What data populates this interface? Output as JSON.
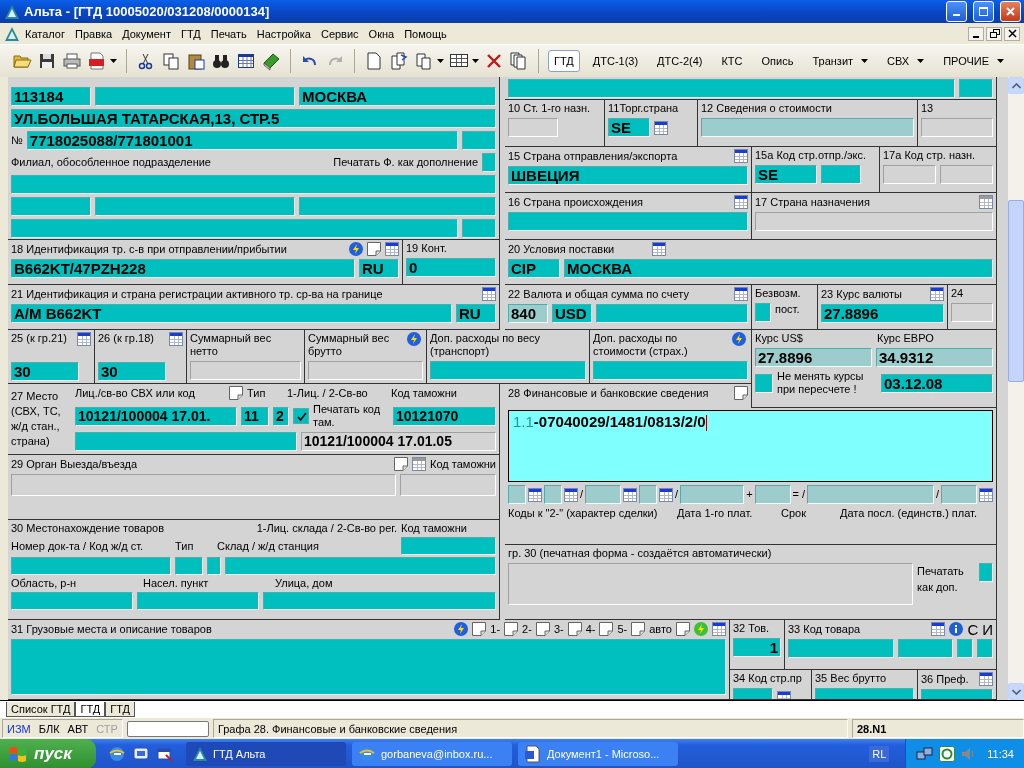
{
  "window": {
    "title": "Альта - [ГТД 10005020/031208/0000134]"
  },
  "menu": [
    "Каталог",
    "Правка",
    "Документ",
    "ГТД",
    "Печать",
    "Настройка",
    "Сервис",
    "Окна",
    "Помощь"
  ],
  "document_tabs": [
    {
      "label": "ГТД",
      "selected": true,
      "has_menu": false
    },
    {
      "label": "ДТС-1(3)",
      "selected": false,
      "has_menu": false
    },
    {
      "label": "ДТС-2(4)",
      "selected": false,
      "has_menu": false
    },
    {
      "label": "КТС",
      "selected": false,
      "has_menu": false
    },
    {
      "label": "Опись",
      "selected": false,
      "has_menu": false
    },
    {
      "label": "Транзит",
      "selected": false,
      "has_menu": true
    },
    {
      "label": "СВХ",
      "selected": false,
      "has_menu": true
    },
    {
      "label": "ПРОЧИЕ",
      "selected": false,
      "has_menu": true
    }
  ],
  "form": {
    "cells": [
      {
        "lines": [
          [
            {
              "kind": "input",
              "value": "113184"
            },
            {
              "kind": "input"
            },
            {
              "kind": "input",
              "value": "МОСКВА"
            }
          ],
          [
            {
              "kind": "input",
              "value": "УЛ.БОЛЬШАЯ ТАТАРСКАЯ,13, СТР.5"
            }
          ],
          [
            {
              "kind": "label",
              "text": "№"
            },
            {
              "kind": "input",
              "value": "7718025088/771801001"
            },
            {
              "kind": "input"
            }
          ],
          [
            {
              "kind": "label",
              "text": "Филиал, обособленное подразделение"
            },
            {
              "kind": "label",
              "text": "Печатать Ф. как дополнение"
            },
            {
              "kind": "input"
            }
          ],
          [
            {
              "kind": "input"
            }
          ],
          [
            {
              "kind": "input"
            },
            {
              "kind": "input"
            },
            {
              "kind": "input"
            }
          ],
          [
            {
              "kind": "input"
            },
            {
              "kind": "input"
            }
          ]
        ]
      },
      {
        "lines": [
          [
            {
              "kind": "input"
            },
            {
              "kind": "input"
            }
          ]
        ]
      },
      {
        "lines": [
          [
            {
              "kind": "label",
              "text": "10 Ст. 1-го назн."
            }
          ],
          [
            {
              "kind": "blank"
            }
          ]
        ]
      },
      {
        "lines": [
          [
            {
              "kind": "label",
              "text": "11Торг.страна"
            }
          ],
          [
            {
              "kind": "input",
              "value": "SE"
            },
            {
              "kind": "picker",
              "disabled": false
            }
          ]
        ]
      },
      {
        "lines": [
          [
            {
              "kind": "label",
              "text": "12 Сведения о стоимости"
            }
          ],
          [
            {
              "kind": "output"
            }
          ]
        ]
      },
      {
        "lines": [
          [
            {
              "kind": "label",
              "text": "13"
            }
          ],
          [
            {
              "kind": "blank"
            }
          ]
        ]
      },
      {
        "lines": [
          [
            {
              "kind": "label",
              "text": "15 Страна отправления/экспорта"
            },
            {
              "kind": "picker",
              "disabled": false
            }
          ],
          [
            {
              "kind": "input",
              "value": "ШВЕЦИЯ"
            }
          ]
        ]
      },
      {
        "lines": [
          [
            {
              "kind": "label",
              "text": "15а Код стр.отпр./экс."
            }
          ],
          [
            {
              "kind": "input",
              "value": "SE"
            },
            {
              "kind": "input"
            }
          ]
        ]
      },
      {
        "lines": [
          [
            {
              "kind": "label",
              "text": "17а Код стр. назн."
            }
          ],
          [
            {
              "kind": "blank"
            },
            {
              "kind": "blank"
            }
          ]
        ]
      },
      {
        "lines": [
          [
            {
              "kind": "label",
              "text": "16 Страна происхождения"
            },
            {
              "kind": "picker",
              "disabled": false
            }
          ],
          [
            {
              "kind": "input"
            }
          ]
        ]
      },
      {
        "lines": [
          [
            {
              "kind": "label",
              "text": "17 Страна назначения"
            },
            {
              "kind": "picker",
              "disabled": true
            }
          ],
          [
            {
              "kind": "blank"
            }
          ]
        ]
      },
      {
        "lines": [
          [
            {
              "kind": "label",
              "text": "18 Идентификация тр. с-в при отправлении/прибытии"
            },
            {
              "kind": "calc",
              "color": "#1f5fe0"
            },
            {
              "kind": "note"
            },
            {
              "kind": "picker",
              "disabled": false
            }
          ],
          [
            {
              "kind": "input",
              "value": "B662KT/47PZH228"
            },
            {
              "kind": "input",
              "value": "RU"
            }
          ]
        ]
      },
      {
        "lines": [
          [
            {
              "kind": "label",
              "text": "19 Конт."
            }
          ],
          [
            {
              "kind": "input",
              "value": "0"
            }
          ]
        ]
      },
      {
        "lines": [
          [
            {
              "kind": "label",
              "text": "20 Условия поставки"
            },
            {
              "kind": "picker",
              "disabled": false
            }
          ],
          [
            {
              "kind": "input",
              "value": "CIP"
            },
            {
              "kind": "input",
              "value": "МОСКВА"
            }
          ]
        ]
      },
      {
        "lines": [
          [
            {
              "kind": "label",
              "text": "21 Идентификация и страна регистрации активного тр. ср-ва на границе"
            },
            {
              "kind": "picker",
              "disabled": false
            }
          ],
          [
            {
              "kind": "input",
              "value": "A/M B662KT"
            },
            {
              "kind": "input",
              "value": "RU"
            }
          ]
        ]
      },
      {
        "lines": [
          [
            {
              "kind": "label",
              "text": "22 Валюта и общая сумма по счету"
            },
            {
              "kind": "picker",
              "disabled": false
            }
          ],
          [
            {
              "kind": "output",
              "value": "840"
            },
            {
              "kind": "input",
              "value": "USD"
            },
            {
              "kind": "input"
            }
          ]
        ]
      },
      {
        "lines": [
          [
            {
              "kind": "label",
              "text": "Безвозм."
            }
          ],
          [
            {
              "kind": "input"
            },
            {
              "kind": "label",
              "text": "пост."
            }
          ]
        ]
      },
      {
        "lines": [
          [
            {
              "kind": "label",
              "text": "23 Курс валюты"
            },
            {
              "kind": "picker",
              "disabled": false
            }
          ],
          [
            {
              "kind": "input",
              "value": "27.8896"
            }
          ]
        ]
      },
      {
        "lines": [
          [
            {
              "kind": "label",
              "text": "24"
            }
          ],
          [
            {
              "kind": "blank"
            }
          ]
        ]
      },
      {
        "lines": [
          [
            {
              "kind": "label",
              "text": "25 (к гр.21)"
            },
            {
              "kind": "picker",
              "disabled": false
            }
          ],
          [
            {
              "kind": "input",
              "value": "30"
            }
          ]
        ]
      },
      {
        "lines": [
          [
            {
              "kind": "label",
              "text": "26 (к гр.18)"
            },
            {
              "kind": "picker",
              "disabled": false
            }
          ],
          [
            {
              "kind": "input",
              "value": "30"
            }
          ]
        ]
      },
      {
        "lines": [
          [
            {
              "kind": "label",
              "text": "Суммарный вес нетто"
            }
          ],
          [
            {
              "kind": "blank"
            }
          ]
        ]
      },
      {
        "lines": [
          [
            {
              "kind": "label",
              "text": "Суммарный вес брутто"
            },
            {
              "kind": "calc",
              "color": "#1f5fe0"
            }
          ],
          [
            {
              "kind": "blank"
            }
          ]
        ]
      },
      {
        "lines": [
          [
            {
              "kind": "label",
              "text": "Доп. расходы по весу (транспорт)"
            }
          ],
          [
            {
              "kind": "input"
            }
          ]
        ]
      },
      {
        "lines": [
          [
            {
              "kind": "label",
              "text": "Доп. расходы по стоимости (страх.)"
            },
            {
              "kind": "calc",
              "color": "#1f5fe0"
            }
          ],
          [
            {
              "kind": "input"
            }
          ]
        ]
      },
      {
        "lines": [
          [
            {
              "kind": "label",
              "text": "Курс US$"
            },
            {
              "kind": "label",
              "text": "Курс ЕВРО"
            }
          ],
          [
            {
              "kind": "output",
              "value": "27.8896"
            },
            {
              "kind": "output",
              "value": "34.9312"
            }
          ],
          [
            {
              "kind": "input"
            },
            {
              "kind": "label",
              "text": "Не менять курсы при пересчете !"
            },
            {
              "kind": "input",
              "value": "03.12.08"
            }
          ]
        ]
      },
      {
        "aside": "27  Место (СВХ, ТС, ж/д стан., страна)",
        "lines": [
          [
            {
              "kind": "label",
              "text": "Лиц./св-во СВХ или код"
            },
            {
              "kind": "note"
            },
            {
              "kind": "label",
              "text": "Тип"
            },
            {
              "kind": "label",
              "text": "1-Лиц. / 2-Св-во"
            },
            {
              "kind": "label",
              "text": "Код таможни"
            }
          ],
          [
            {
              "kind": "input",
              "value": "10121/100004 17.01."
            },
            {
              "kind": "input",
              "value": "11"
            },
            {
              "kind": "input",
              "value": "2"
            },
            {
              "kind": "checkbox",
              "checked": true
            },
            {
              "kind": "label",
              "text": "Печатать код там."
            },
            {
              "kind": "input",
              "value": "10121070"
            }
          ],
          [
            {
              "kind": "input"
            },
            {
              "kind": "blank",
              "value": "10121/100004 17.01.05"
            }
          ]
        ]
      },
      {
        "lines": [
          [
            {
              "kind": "label",
              "text": "28 Финансовые и банковские сведения"
            },
            {
              "kind": "note"
            }
          ]
        ]
      },
      {
        "lines": [
          [
            {
              "kind": "label",
              "text": "29 Орган Выезда/въезда"
            },
            {
              "kind": "note"
            },
            {
              "kind": "picker",
              "disabled": true
            },
            {
              "kind": "label",
              "text": "Код таможни"
            }
          ],
          [
            {
              "kind": "blank"
            },
            {
              "kind": "blank"
            }
          ]
        ]
      },
      {
        "lines": [
          [
            {
              "kind": "memo",
              "prefix": "1.1",
              "value": "-07040029/1481/0813/2/0"
            }
          ],
          [
            {
              "kind": "output"
            },
            {
              "kind": "picker",
              "disabled": false
            },
            {
              "kind": "output"
            },
            {
              "kind": "picker",
              "disabled": false
            },
            {
              "kind": "label",
              "text": "/"
            },
            {
              "kind": "output"
            },
            {
              "kind": "picker",
              "disabled": false
            },
            {
              "kind": "output"
            },
            {
              "kind": "picker",
              "disabled": false
            },
            {
              "kind": "label",
              "text": "/"
            },
            {
              "kind": "output"
            },
            {
              "kind": "label",
              "text": "+"
            },
            {
              "kind": "output"
            },
            {
              "kind": "label",
              "text": "= /"
            },
            {
              "kind": "output"
            },
            {
              "kind": "label",
              "text": "/"
            },
            {
              "kind": "output"
            },
            {
              "kind": "picker",
              "disabled": false
            }
          ],
          [
            {
              "kind": "label",
              "text": "Коды к \"2-\" (характер сделки)"
            },
            {
              "kind": "label",
              "text": "Дата 1-го плат."
            },
            {
              "kind": "label",
              "text": "Срок"
            },
            {
              "kind": "label",
              "text": "Дата посл. (единств.) плат."
            }
          ]
        ]
      },
      {
        "lines": [
          [
            {
              "kind": "label",
              "text": "30 Местонахождение товаров"
            },
            {
              "kind": "label",
              "text": "1-Лиц. склада / 2-Св-во рег."
            },
            {
              "kind": "label",
              "text": "Код таможни"
            }
          ],
          [
            {
              "kind": "label",
              "text": "Номер док-та / Код ж/д ст."
            },
            {
              "kind": "label",
              "text": "Тип"
            },
            {
              "kind": "label",
              "text": "Склад / ж/д станция"
            },
            {
              "kind": "input"
            }
          ],
          [
            {
              "kind": "input"
            },
            {
              "kind": "input"
            },
            {
              "kind": "input"
            },
            {
              "kind": "input"
            }
          ],
          [
            {
              "kind": "label",
              "text": "Область, р-н"
            },
            {
              "kind": "label",
              "text": "Насел. пункт"
            },
            {
              "kind": "label",
              "text": "Улица, дом"
            }
          ],
          [
            {
              "kind": "input"
            },
            {
              "kind": "input"
            },
            {
              "kind": "input"
            }
          ]
        ]
      },
      {
        "lines": [
          [
            {
              "kind": "label",
              "text": "гр. 30 (печатная форма - создаётся автоматически)"
            }
          ],
          [
            {
              "kind": "blank"
            },
            {
              "kind": "label",
              "text": "Печатать как доп."
            },
            {
              "kind": "input"
            }
          ]
        ]
      },
      {
        "lines": [
          [
            {
              "kind": "label",
              "text": "31 Грузовые места и описание товаров"
            },
            {
              "kind": "calc",
              "color": "#1f5fe0"
            },
            {
              "kind": "note"
            },
            {
              "kind": "label",
              "text": "1-"
            },
            {
              "kind": "note"
            },
            {
              "kind": "label",
              "text": "2-"
            },
            {
              "kind": "note"
            },
            {
              "kind": "label",
              "text": "3-"
            },
            {
              "kind": "note"
            },
            {
              "kind": "label",
              "text": "4-"
            },
            {
              "kind": "note"
            },
            {
              "kind": "label",
              "text": "5-"
            },
            {
              "kind": "note"
            },
            {
              "kind": "label",
              "text": "авто"
            },
            {
              "kind": "note"
            },
            {
              "kind": "calc",
              "color": "#3cc03c"
            },
            {
              "kind": "picker",
              "disabled": false
            }
          ],
          [
            {
              "kind": "input"
            }
          ]
        ]
      },
      {
        "lines": [
          [
            {
              "kind": "label",
              "text": "32 Тов."
            }
          ],
          [
            {
              "kind": "input",
              "value": "1"
            }
          ]
        ]
      },
      {
        "lines": [
          [
            {
              "kind": "label",
              "text": "33 Код товара"
            },
            {
              "kind": "picker",
              "disabled": false
            },
            {
              "kind": "info"
            },
            {
              "kind": "label",
              "text": "С"
            },
            {
              "kind": "label",
              "text": "И"
            }
          ],
          [
            {
              "kind": "input"
            },
            {
              "kind": "input"
            },
            {
              "kind": "input"
            },
            {
              "kind": "input"
            }
          ]
        ]
      },
      {
        "lines": [
          [
            {
              "kind": "label",
              "text": "34 Код стр.пр"
            }
          ],
          [
            {
              "kind": "input"
            },
            {
              "kind": "picker",
              "disabled": false
            }
          ]
        ]
      },
      {
        "lines": [
          [
            {
              "kind": "label",
              "text": "35 Вес брутто"
            }
          ],
          [
            {
              "kind": "input"
            }
          ]
        ]
      },
      {
        "lines": [
          [
            {
              "kind": "label",
              "text": "36 Преф."
            },
            {
              "kind": "picker",
              "disabled": false
            }
          ],
          [
            {
              "kind": "input"
            }
          ]
        ]
      }
    ]
  },
  "sheet_tabs": [
    {
      "label": "Список ГТД",
      "selected": false
    },
    {
      "label": "ГТД",
      "selected": true
    },
    {
      "label": "ГТД",
      "selected": false
    }
  ],
  "status_bar": {
    "indicators": [
      {
        "label": "ИЗМ",
        "highlighted": true,
        "disabled": false
      },
      {
        "label": "БЛК",
        "highlighted": false,
        "disabled": false
      },
      {
        "label": "АВТ",
        "highlighted": false,
        "disabled": false
      },
      {
        "label": "СТР",
        "highlighted": false,
        "disabled": true
      }
    ],
    "message": "Графа 28. Финансовые и банковские сведения",
    "position": "28.N1"
  },
  "taskbar": {
    "start": "пуск",
    "tasks": [
      {
        "label": "ГТД Альта",
        "selected": true
      },
      {
        "label": "gorbaneva@inbox.ru...",
        "selected": false
      },
      {
        "label": "Документ1 - Microso...",
        "selected": false
      }
    ],
    "language": "RL",
    "clock": "11:34"
  }
}
